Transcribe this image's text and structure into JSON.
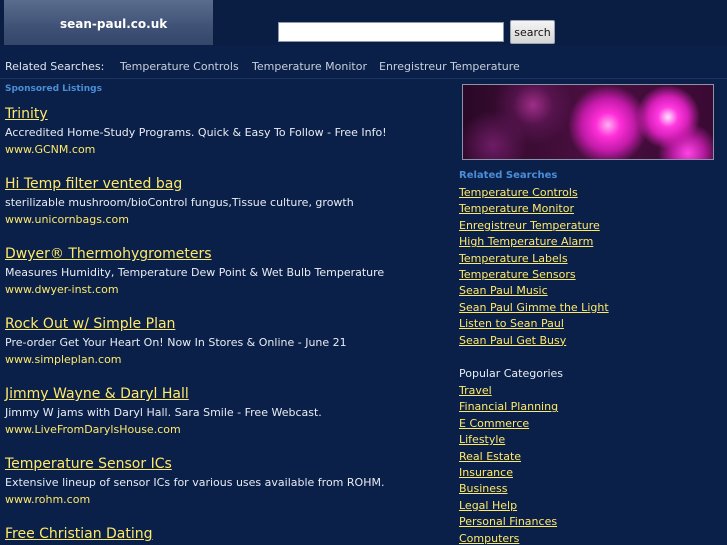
{
  "header": {
    "site_name": "sean-paul.co.uk",
    "search_value": "",
    "search_button_label": "search"
  },
  "related_bar": {
    "label": "Related Searches:",
    "links": [
      "Temperature Controls",
      "Temperature Monitor",
      "Enregistreur Temperature"
    ]
  },
  "sponsored": {
    "heading": "Sponsored Listings",
    "listings": [
      {
        "title": "Trinity",
        "desc": "Accredited Home-Study Programs. Quick & Easy To Follow - Free Info!",
        "url": "www.GCNM.com"
      },
      {
        "title": "Hi Temp filter vented bag",
        "desc": "sterilizable mushroom/bioControl fungus,Tissue culture, growth",
        "url": "www.unicornbags.com"
      },
      {
        "title": "Dwyer® Thermohygrometers",
        "desc": "Measures Humidity, Temperature Dew Point & Wet Bulb Temperature",
        "url": "www.dwyer-inst.com"
      },
      {
        "title": "Rock Out w/ Simple Plan",
        "desc": "Pre-order Get Your Heart On! Now In Stores & Online - June 21",
        "url": "www.simpleplan.com"
      },
      {
        "title": "Jimmy Wayne & Daryl Hall",
        "desc": "Jimmy W jams with Daryl Hall. Sara Smile - Free Webcast.",
        "url": "www.LiveFromDarylsHouse.com"
      },
      {
        "title": "Temperature Sensor ICs",
        "desc": "Extensive lineup of sensor ICs for various uses available from ROHM.",
        "url": "www.rohm.com"
      },
      {
        "title": "Free Christian Dating",
        "desc": "",
        "url": ""
      }
    ]
  },
  "sidebar": {
    "related_heading": "Related Searches",
    "related_links": [
      "Temperature Controls",
      "Temperature Monitor",
      "Enregistreur Temperature",
      "High Temperature Alarm",
      "Temperature Labels",
      "Temperature Sensors",
      "Sean Paul Music",
      "Sean Paul Gimme the Light",
      "Listen to Sean Paul",
      "Sean Paul Get Busy"
    ],
    "popular_heading": "Popular Categories",
    "popular_links": [
      "Travel",
      "Financial Planning",
      "E Commerce",
      "Lifestyle",
      "Real Estate",
      "Insurance",
      "Business",
      "Legal Help",
      "Personal Finances",
      "Computers"
    ]
  },
  "colors": {
    "background": "#0b2048",
    "link": "#ffe96a",
    "section_heading": "#4a8ed8"
  }
}
